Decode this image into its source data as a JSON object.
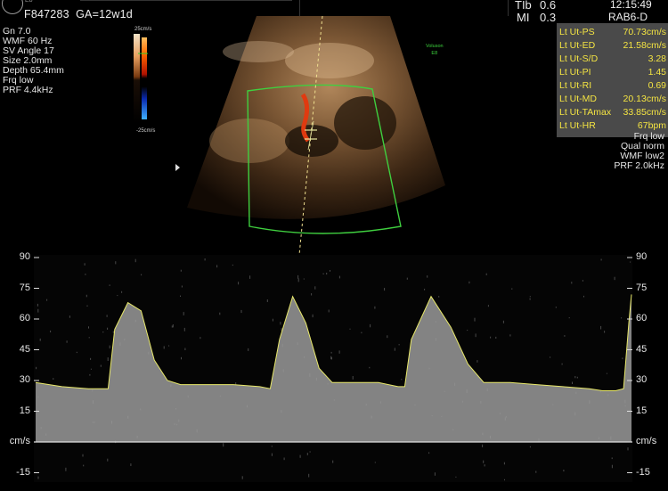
{
  "header": {
    "logo_model": "E8",
    "patient_id": "F847283",
    "gestational_age": "GA=12w1d",
    "tib_label": "TIb",
    "tib_value": "0.6",
    "mi_label": "MI",
    "mi_value": "0.3",
    "time": "12:15:49",
    "probe": "RAB6-D"
  },
  "left_params": [
    "Gn  7.0",
    "WMF 60 Hz",
    "SV Angle 17",
    "Size  2.0mm",
    "Depth 65.4mm",
    "Frq low",
    "PRF  4.4kHz"
  ],
  "color_scale": {
    "top": "25cm/s",
    "bottom": "-25cm/s"
  },
  "voluson_badge": {
    "line1": "Voluson",
    "line2": "E8",
    "color": "#3cd13c"
  },
  "measurements": [
    {
      "label": "Lt Ut-PS",
      "value": "70.73cm/s"
    },
    {
      "label": "Lt Ut-ED",
      "value": "21.58cm/s"
    },
    {
      "label": "Lt Ut-S/D",
      "value": "3.28"
    },
    {
      "label": "Lt Ut-PI",
      "value": "1.45"
    },
    {
      "label": "Lt Ut-RI",
      "value": "0.69"
    },
    {
      "label": "Lt Ut-MD",
      "value": "20.13cm/s"
    },
    {
      "label": "Lt Ut-TAmax",
      "value": "33.85cm/s"
    },
    {
      "label": "Lt Ut-HR",
      "value": "67bpm"
    }
  ],
  "right_params": [
    "Frq low",
    "Qual norm",
    "WMF low2",
    "PRF  2.0kHz"
  ],
  "spectral": {
    "y_ticks": [
      "90",
      "75",
      "60",
      "45",
      "30",
      "15",
      "cm/s",
      "-15"
    ],
    "tick_values": [
      90,
      75,
      60,
      45,
      30,
      15,
      0,
      -15
    ],
    "envelope": [
      [
        0,
        29
      ],
      [
        20,
        27
      ],
      [
        40,
        26
      ],
      [
        55,
        26
      ],
      [
        60,
        55
      ],
      [
        70,
        68
      ],
      [
        80,
        64
      ],
      [
        90,
        40
      ],
      [
        100,
        30
      ],
      [
        110,
        28
      ],
      [
        130,
        28
      ],
      [
        150,
        28
      ],
      [
        170,
        27
      ],
      [
        178,
        26
      ],
      [
        185,
        50
      ],
      [
        195,
        71
      ],
      [
        205,
        58
      ],
      [
        215,
        36
      ],
      [
        225,
        29
      ],
      [
        245,
        29
      ],
      [
        260,
        29
      ],
      [
        275,
        27
      ],
      [
        280,
        27
      ],
      [
        285,
        50
      ],
      [
        300,
        71
      ],
      [
        315,
        56
      ],
      [
        328,
        38
      ],
      [
        340,
        29
      ],
      [
        360,
        29
      ],
      [
        380,
        28
      ],
      [
        400,
        27
      ],
      [
        420,
        26
      ],
      [
        430,
        25
      ],
      [
        440,
        25
      ],
      [
        446,
        26
      ],
      [
        450,
        58
      ],
      [
        452,
        72
      ]
    ],
    "accent": "#e8e86a"
  }
}
